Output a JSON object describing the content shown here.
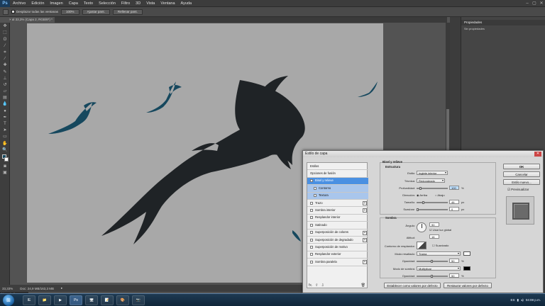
{
  "app": {
    "logo": "Ps",
    "menu": [
      "Archivo",
      "Edición",
      "Imagen",
      "Capa",
      "Texto",
      "Selección",
      "Filtro",
      "3D",
      "Vista",
      "Ventana",
      "Ayuda"
    ],
    "window_controls": [
      "–",
      "▢",
      "✕"
    ]
  },
  "options_bar": {
    "zoom_btn": "100%",
    "fit_btn": "Ajustar pant.",
    "fill_btn": "Rellenar pant.",
    "scroll_all_label": "Desplazar todas las ventanas"
  },
  "document": {
    "tab_label": "× al 33,3% (Capa 2, RGB/8*) *",
    "zoom": "33,33%",
    "doc_info": "Doc: 24,9 MB/163,3 MB",
    "mini_bridge": "Línea de tiempo"
  },
  "right_panel": {
    "title": "Propiedades",
    "subtitle": "Sin propiedades"
  },
  "dialog": {
    "title": "Estilo de capa",
    "close": "✕",
    "styles_list": [
      {
        "label": "Estilos",
        "checkbox": false,
        "plus": false,
        "state": "normal"
      },
      {
        "label": "Opciones de fusión",
        "checkbox": false,
        "plus": false,
        "state": "normal"
      },
      {
        "label": "Bisel y relieve",
        "checkbox": true,
        "plus": false,
        "state": "selected"
      },
      {
        "label": "Contorno",
        "checkbox": true,
        "plus": false,
        "state": "sub"
      },
      {
        "label": "Textura",
        "checkbox": true,
        "plus": false,
        "state": "sub"
      },
      {
        "label": "Trazo",
        "checkbox": true,
        "plus": true,
        "state": "normal"
      },
      {
        "label": "Sombra interior",
        "checkbox": true,
        "plus": true,
        "state": "normal"
      },
      {
        "label": "Resplandor interior",
        "checkbox": true,
        "plus": false,
        "state": "normal"
      },
      {
        "label": "Satinado",
        "checkbox": true,
        "plus": false,
        "state": "normal"
      },
      {
        "label": "Superposición de colores",
        "checkbox": true,
        "plus": true,
        "state": "normal"
      },
      {
        "label": "Superposición de degradado",
        "checkbox": true,
        "plus": true,
        "state": "normal"
      },
      {
        "label": "Superposición de motivo",
        "checkbox": true,
        "plus": false,
        "state": "normal"
      },
      {
        "label": "Resplandor exterior",
        "checkbox": true,
        "plus": false,
        "state": "normal"
      },
      {
        "label": "Sombra paralela",
        "checkbox": true,
        "plus": true,
        "state": "normal"
      }
    ],
    "list_footer": {
      "fx": "fx.",
      "up": "⇧",
      "down": "⇩",
      "trash": "🗑"
    },
    "bevel": {
      "group_title": "Bisel y relieve",
      "struct_title": "Estructura",
      "estilo_label": "Estilo:",
      "estilo_value": "Inglete interior",
      "tecnica_label": "Técnica:",
      "tecnica_value": "Redondeado",
      "profundidad_label": "Profundidad:",
      "profundidad_value": "100",
      "profundidad_unit": "%",
      "direccion_label": "Dirección:",
      "dir_up": "Arriba",
      "dir_down": "Abajo",
      "tamano_label": "Tamaño:",
      "tamano_value": "46",
      "tamano_unit": "px",
      "suavizar_label": "Suavizar:",
      "suavizar_value": "0",
      "suavizar_unit": "px"
    },
    "shading": {
      "group_title": "Sombra",
      "angulo_label": "Ángulo:",
      "angulo_value": "90",
      "usar_luz": "Usar luz global",
      "altitud_label": "Altitud:",
      "altitud_value": "16",
      "contorno_label": "Contorno de resplandor:",
      "suavizado": "Suavizado",
      "modo_resaltado_label": "Modo resaltado:",
      "modo_resaltado_value": "Trama",
      "opacidad1_label": "Opacidad:",
      "opacidad1_value": "50",
      "modo_sombra_label": "Modo de sombra:",
      "modo_sombra_value": "Multiplicar",
      "opacidad2_label": "Opacidad:",
      "opacidad2_value": "50",
      "pct": "%",
      "highlight_color": "#ffffff",
      "shadow_color": "#000000"
    },
    "default_btn": "Establecer como valores por defecto",
    "reset_btn": "Restaurar valores por defecto",
    "ok": "OK",
    "cancel": "Cancelar",
    "new_style": "Estilo nuevo...",
    "preview_label": "Previsualizar"
  },
  "taskbar": {
    "start": "⊞",
    "time": "04:08 p.m.",
    "lang": "ES",
    "apps": [
      "IE",
      "📁",
      "▶",
      "Ps",
      "🖥",
      "📝",
      "🎨",
      "📷"
    ]
  },
  "colors": {
    "shark_large": "#1f2326",
    "shark_small": "#16485e",
    "canvas_bg": "#a8a8a8",
    "selection": "#4a90e2"
  }
}
